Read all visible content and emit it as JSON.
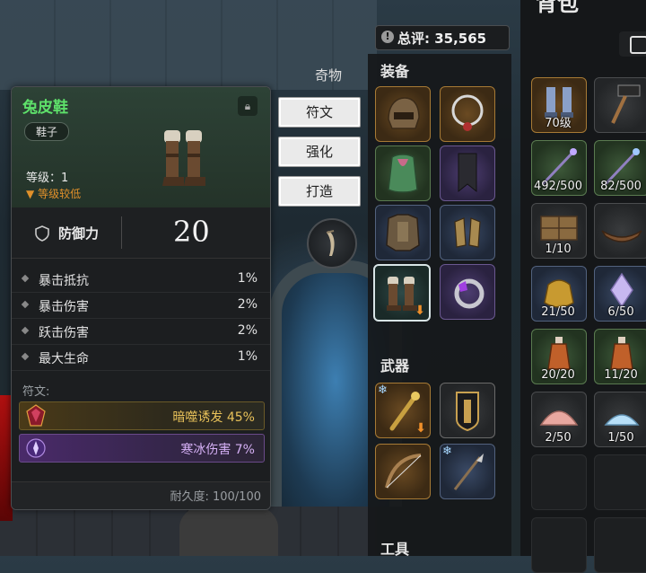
{
  "tooltip": {
    "item_name": "兔皮鞋",
    "item_type": "鞋子",
    "level": "等级：1",
    "level_warning": "等级较低",
    "defense_label": "防御力",
    "defense_value": "20",
    "stats": [
      {
        "name": "暴击抵抗",
        "value": "1%"
      },
      {
        "name": "暴击伤害",
        "value": "2%"
      },
      {
        "name": "跃击伤害",
        "value": "2%"
      },
      {
        "name": "最大生命",
        "value": "1%"
      }
    ],
    "runes_label": "符文:",
    "runes": [
      {
        "text": "暗噬诱发 45%",
        "color": "#e9c25a"
      },
      {
        "text": "寒冰伤害 7%",
        "color": "#d5b0f5"
      }
    ],
    "durability": "耐久度: 100/100"
  },
  "actions": {
    "curio_label": "奇物",
    "rune_button": "符文",
    "enhance_button": "强化",
    "craft_button": "打造"
  },
  "equipment": {
    "score": "总评: 35,565",
    "equip_label": "装备",
    "weapons_label": "武器",
    "tools_label": "工具",
    "slots": [
      {
        "name": "helmet",
        "rarity": "orange"
      },
      {
        "name": "necklace",
        "rarity": "orange"
      },
      {
        "name": "cloak",
        "rarity": "green"
      },
      {
        "name": "banner",
        "rarity": "purple"
      },
      {
        "name": "chest-armor",
        "rarity": "blue"
      },
      {
        "name": "gauntlets",
        "rarity": "blue"
      },
      {
        "name": "boots",
        "rarity": "selected"
      },
      {
        "name": "ring",
        "rarity": "purple"
      }
    ],
    "weapons": [
      {
        "name": "staff",
        "rarity": "orange"
      },
      {
        "name": "shield",
        "rarity": "gray"
      },
      {
        "name": "bow",
        "rarity": "orange"
      },
      {
        "name": "spear",
        "rarity": "blue"
      }
    ]
  },
  "backpack": {
    "title": "背包",
    "items": [
      {
        "name": "boots",
        "qty": "70级",
        "rarity": "orange"
      },
      {
        "name": "hammer",
        "qty": "",
        "rarity": "gray"
      },
      {
        "name": "staff-a",
        "qty": "492/500",
        "rarity": "green"
      },
      {
        "name": "staff-b",
        "qty": "82/500",
        "rarity": "green"
      },
      {
        "name": "planks",
        "qty": "1/10",
        "rarity": "gray"
      },
      {
        "name": "boat",
        "qty": "",
        "rarity": "gray"
      },
      {
        "name": "gold-pouch",
        "qty": "21/50",
        "rarity": "blue"
      },
      {
        "name": "crystal",
        "qty": "6/50",
        "rarity": "blue"
      },
      {
        "name": "potion-a",
        "qty": "20/20",
        "rarity": "green"
      },
      {
        "name": "potion-b",
        "qty": "11/20",
        "rarity": "green"
      },
      {
        "name": "shell",
        "qty": "2/50",
        "rarity": "gray"
      },
      {
        "name": "ice-shard",
        "qty": "1/50",
        "rarity": "gray"
      }
    ]
  }
}
